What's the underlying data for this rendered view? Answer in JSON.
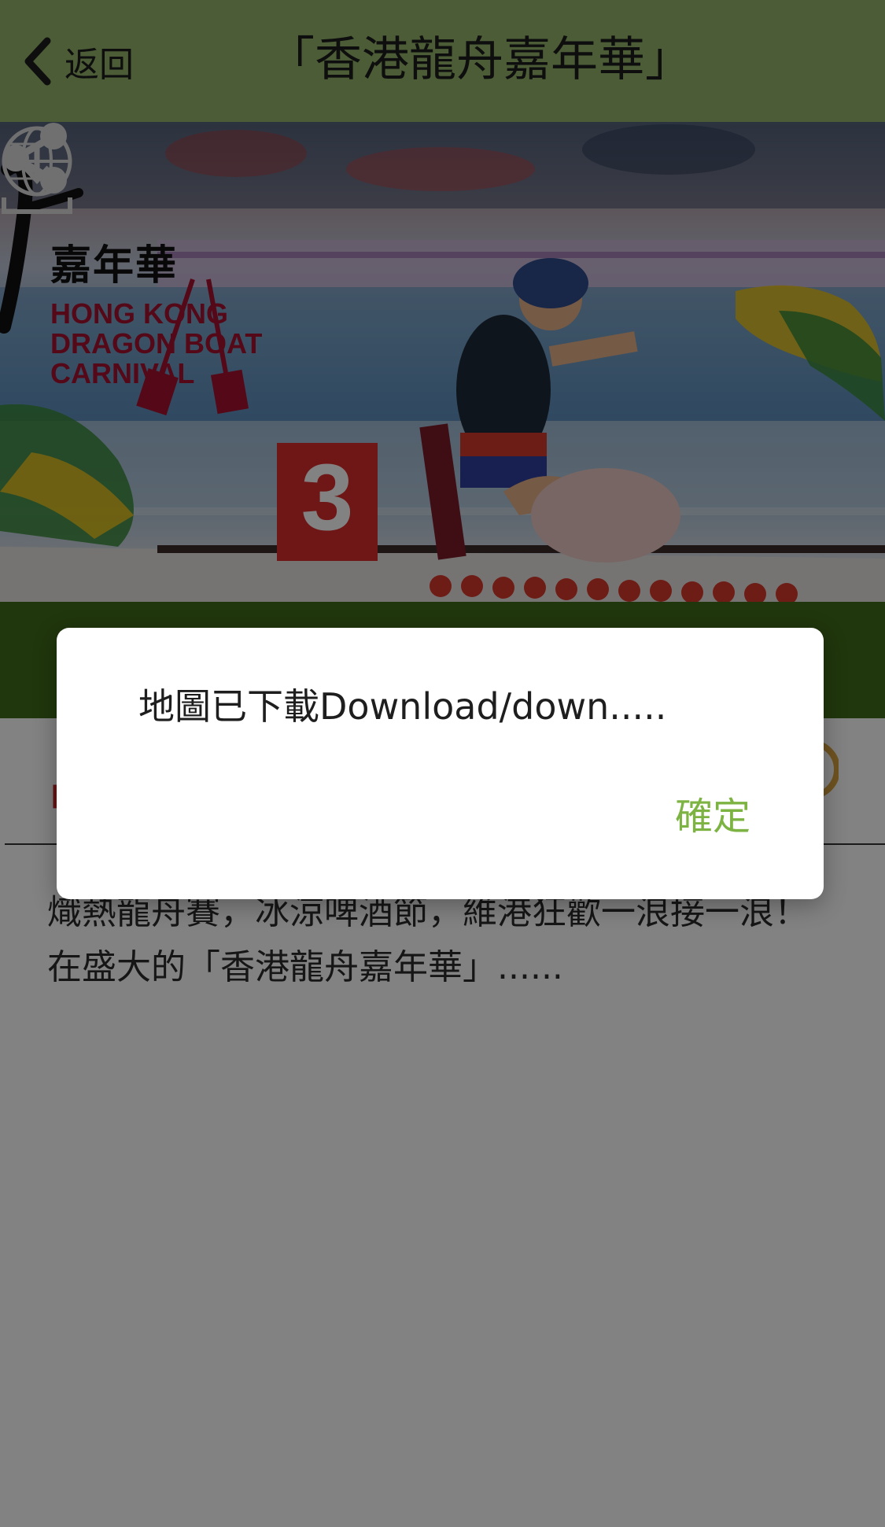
{
  "header": {
    "back_label": "返回",
    "title": "「香港龍舟嘉年華」"
  },
  "banner": {
    "logo_cn": "嘉年華",
    "logo_en_lines": [
      "HONG KONG",
      "DRAGON BOAT",
      "CARNIVAL"
    ],
    "boat_number": "3",
    "download_icon": "globe-download-icon",
    "share_icon": "share-icon"
  },
  "content": {
    "description": "熾熱龍舟賽，冰涼啤酒節，維港狂歡一浪接一浪！在盛大的「香港龍舟嘉年華」......"
  },
  "dialog": {
    "message": "地圖已下載Download/down.....",
    "ok_label": "確定"
  },
  "colors": {
    "header_bg": "#93b46a",
    "band_green": "#3f6a18",
    "accent_green": "#7cb342",
    "tab_red": "#c4282b"
  }
}
